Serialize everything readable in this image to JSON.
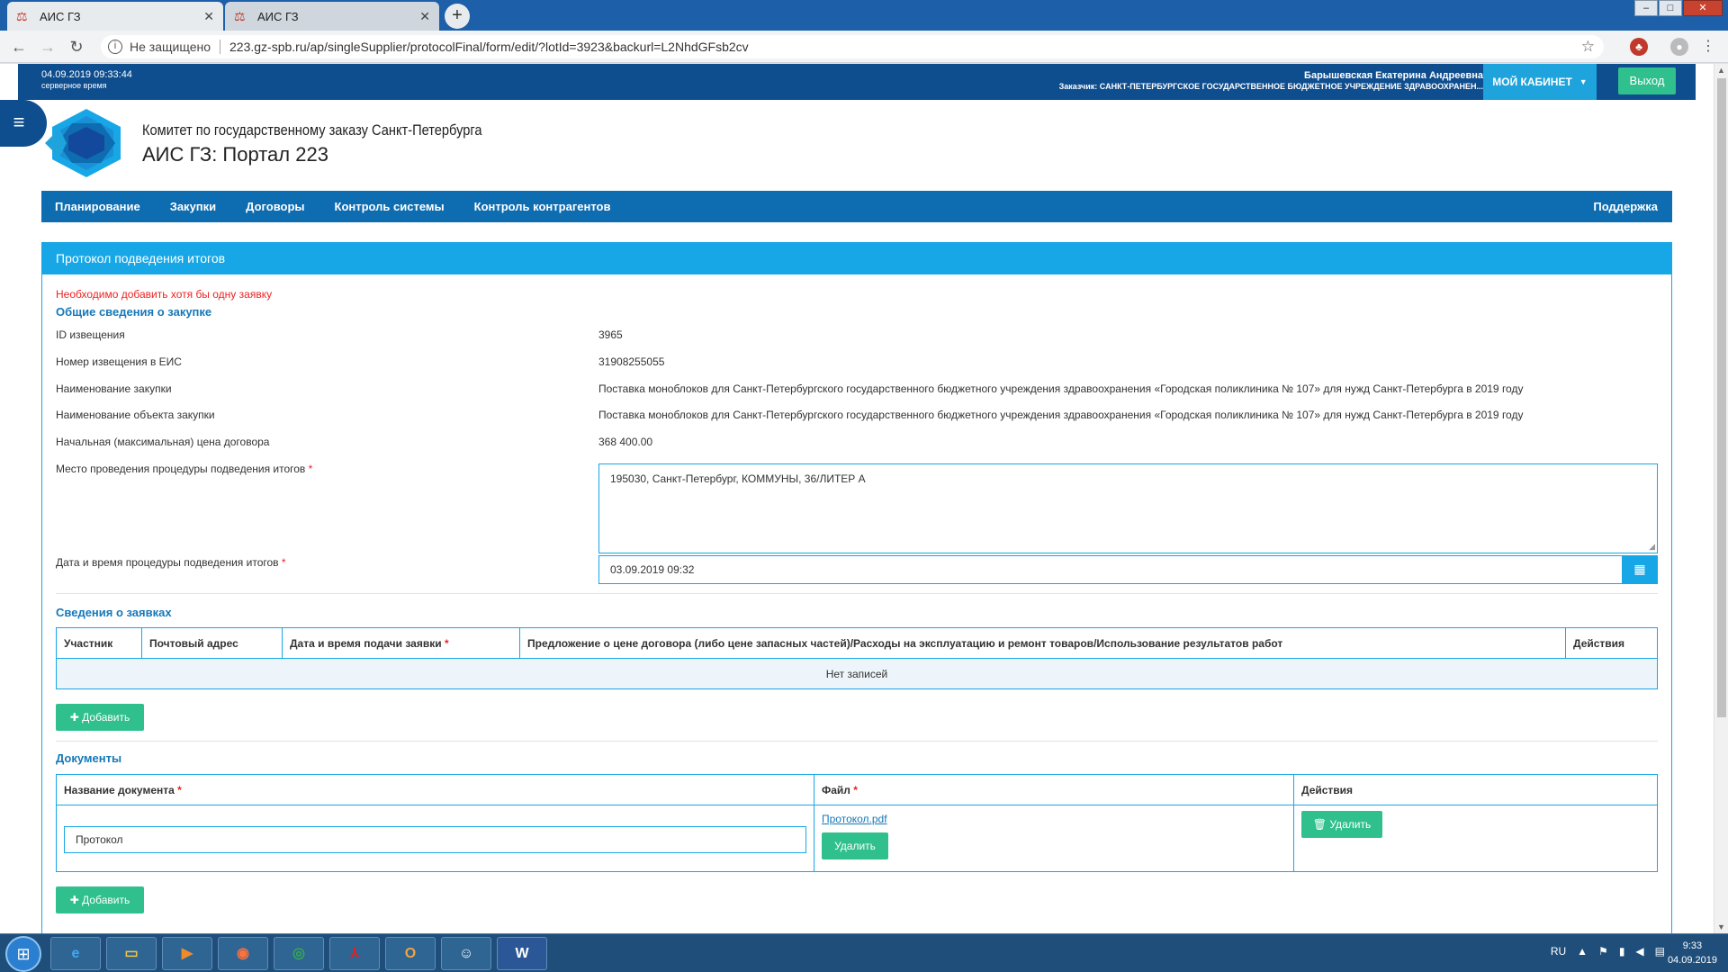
{
  "browser": {
    "tabs": [
      {
        "title": "АИС ГЗ",
        "active": true
      },
      {
        "title": "АИС ГЗ",
        "active": false
      }
    ],
    "new_tab": "+",
    "security": "Не защищено",
    "url": "223.gz-spb.ru/ap/singleSupplier/protocolFinal/form/edit/?lotId=3923&backurl=L2NhdGFsb2cv"
  },
  "header": {
    "datetime": "04.09.2019 09:33:44",
    "server_time_label": "серверное время",
    "user_name": "Барышевская Екатерина Андреевна",
    "customer": "Заказчик: САНКТ-ПЕТЕРБУРГСКОЕ ГОСУДАРСТВЕННОЕ БЮДЖЕТНОЕ УЧРЕЖДЕНИЕ ЗДРАВООХРАНЕН...",
    "cabinet_label": "МОЙ КАБИНЕТ",
    "logout_label": "Выход",
    "org_name": "Комитет по государственному заказу Санкт-Петербурга",
    "portal_name": "АИС ГЗ: Портал 223"
  },
  "nav": {
    "items": [
      "Планирование",
      "Закупки",
      "Договоры",
      "Контроль системы",
      "Контроль контрагентов"
    ],
    "support": "Поддержка"
  },
  "form": {
    "title": "Протокол подведения итогов",
    "error": "Необходимо добавить хотя бы одну заявку",
    "general_section": "Общие сведения о закупке",
    "fields": {
      "id_label": "ID извещения",
      "id_value": "3965",
      "eis_label": "Номер извещения в ЕИС",
      "eis_value": "31908255055",
      "name_label": "Наименование закупки",
      "name_value": "Поставка моноблоков для Санкт-Петербургского государственного бюджетного учреждения здравоохранения «Городская поликлиника № 107» для нужд Санкт-Петербурга в 2019 году",
      "object_label": "Наименование объекта закупки",
      "object_value": "Поставка моноблоков для Санкт-Петербургского государственного бюджетного учреждения здравоохранения «Городская поликлиника № 107» для нужд Санкт-Петербурга в 2019 году",
      "price_label": "Начальная (максимальная) цена договора",
      "price_value": "368 400.00",
      "place_label": "Место проведения процедуры подведения итогов",
      "place_value": "195030, Санкт-Петербург, КОММУНЫ, 36/ЛИТЕР А",
      "date_label": "Дата и время процедуры подведения итогов",
      "date_value": "03.09.2019 09:32",
      "required_mark": "*"
    },
    "applications": {
      "title": "Сведения о заявках",
      "columns": [
        "Участник",
        "Почтовый адрес",
        "Дата и время подачи заявки",
        "Предложение о цене договора (либо цене запасных частей)/Расходы на эксплуатацию и ремонт товаров/Использование результатов работ",
        "Действия"
      ],
      "empty": "Нет записей",
      "add_label": "Добавить"
    },
    "documents": {
      "title": "Документы",
      "columns": [
        "Название документа",
        "Файл",
        "Действия"
      ],
      "rows": [
        {
          "name": "Протокол",
          "file": "Протокол.pdf",
          "delete_file_label": "Удалить",
          "delete_row_label": "Удалить"
        }
      ],
      "add_label": "Добавить"
    }
  },
  "taskbar": {
    "lang": "RU",
    "time": "9:33",
    "date": "04.09.2019"
  },
  "colors": {
    "primary": "#17a7e6",
    "dark_blue": "#0e4d8e",
    "nav_blue": "#0e6cb0",
    "green": "#2fc08e",
    "error": "#ee2222"
  }
}
